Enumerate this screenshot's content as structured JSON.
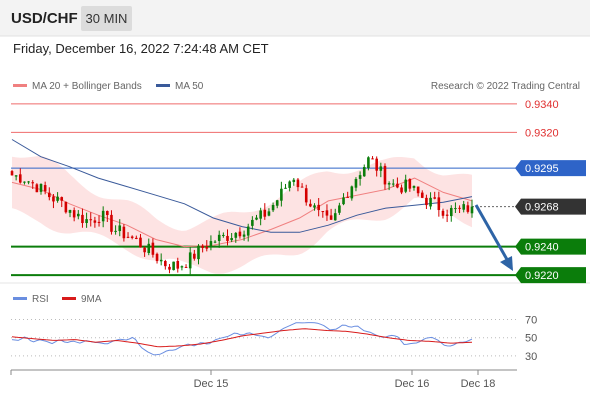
{
  "header": {
    "symbol": "USD/CHF",
    "timeframe": "30 MIN"
  },
  "datetime": "Friday, December 16, 2022 7:24:48 AM CET",
  "legend": {
    "ma20_label": "MA 20 + Bollinger Bands",
    "ma50_label": "MA 50",
    "credit": "Research © 2022 Trading Central",
    "rsi_label": "RSI",
    "rsi_ma_label": "9MA"
  },
  "colors": {
    "resistance": "#ef6b6b",
    "pivot": "#2e64c8",
    "current": "#333333",
    "support": "#0b7d0b",
    "bollinger_fill": "#fde3e3",
    "ma20": "#f08080",
    "ma50": "#3a5a9a",
    "candle_up": "#0b7d0b",
    "candle_down": "#d40000",
    "arrow": "#2e64a6",
    "rsi": "#6a8ee0",
    "rsi_ma": "#d81b1b"
  },
  "chart_data": [
    {
      "type": "candlestick",
      "y_range": [
        0.92145,
        0.93455
      ],
      "x_labels": [
        "Dec 15",
        "Dec 16",
        "Dec 18"
      ],
      "levels": [
        {
          "value": 0.934,
          "label": "0.9340",
          "kind": "resistance"
        },
        {
          "value": 0.932,
          "label": "0.9320",
          "kind": "resistance"
        },
        {
          "value": 0.9295,
          "label": "0.9295",
          "kind": "pivot"
        },
        {
          "value": 0.9268,
          "label": "0.9268",
          "kind": "current"
        },
        {
          "value": 0.924,
          "label": "0.9240",
          "kind": "support"
        },
        {
          "value": 0.922,
          "label": "0.9220",
          "kind": "support"
        }
      ],
      "anchors": [
        0.929,
        0.9288,
        0.9282,
        0.9275,
        0.927,
        0.9262,
        0.9258,
        0.9262,
        0.9252,
        0.9248,
        0.9242,
        0.9235,
        0.9228,
        0.9226,
        0.9232,
        0.924,
        0.9245,
        0.9248,
        0.9252,
        0.9258,
        0.9264,
        0.9276,
        0.929,
        0.9275,
        0.9262,
        0.9255,
        0.9275,
        0.929,
        0.9302,
        0.929,
        0.9282,
        0.9282,
        0.9275,
        0.927,
        0.9265,
        0.9265,
        0.9268
      ],
      "ma50": [
        0.9315,
        0.9303,
        0.9296,
        0.9288,
        0.9282,
        0.9276,
        0.927,
        0.926,
        0.9254,
        0.925,
        0.925,
        0.9255,
        0.9262,
        0.9267,
        0.9269,
        0.9271,
        0.9275
      ],
      "ma20": [
        0.9285,
        0.928,
        0.927,
        0.9262,
        0.9255,
        0.9245,
        0.924,
        0.9241,
        0.9245,
        0.9252,
        0.926,
        0.9272,
        0.9276,
        0.928,
        0.9288,
        0.9278,
        0.9272
      ]
    },
    {
      "type": "line",
      "title": "RSI",
      "y_ticks": [
        "70",
        "50",
        "30"
      ],
      "y_range": [
        20,
        75
      ],
      "series": [
        {
          "name": "RSI",
          "values": [
            50,
            47,
            44,
            50,
            41,
            52,
            46,
            30,
            42,
            45,
            48,
            54,
            50,
            62,
            66,
            60,
            64,
            58,
            50,
            45,
            47,
            42,
            46
          ]
        },
        {
          "name": "9MA",
          "values": [
            51,
            49,
            47,
            48,
            45,
            47,
            44,
            40,
            41,
            43,
            47,
            52,
            55,
            58,
            60,
            58,
            57,
            54,
            50,
            47,
            46,
            44,
            45
          ]
        }
      ]
    }
  ]
}
